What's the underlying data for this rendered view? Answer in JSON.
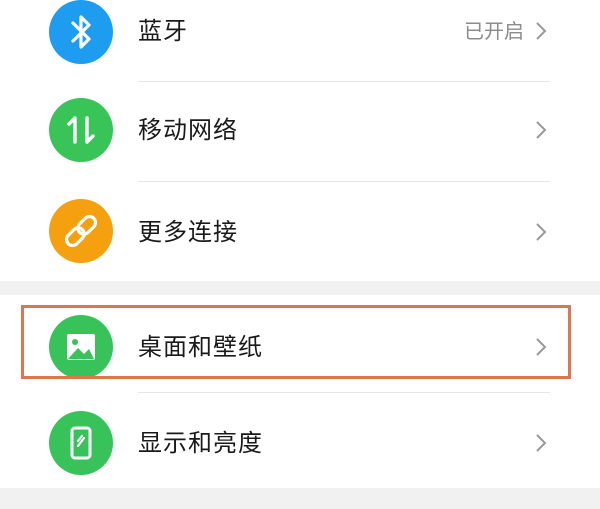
{
  "settings": {
    "items": [
      {
        "label": "蓝牙",
        "status": "已开启",
        "icon": "bluetooth-icon",
        "color": "#1e9cf0"
      },
      {
        "label": "移动网络",
        "status": "",
        "icon": "mobile-data-icon",
        "color": "#39c458"
      },
      {
        "label": "更多连接",
        "status": "",
        "icon": "link-icon",
        "color": "#f5a00f"
      },
      {
        "label": "桌面和壁纸",
        "status": "",
        "icon": "image-icon",
        "color": "#37c35a",
        "highlighted": true
      },
      {
        "label": "显示和亮度",
        "status": "",
        "icon": "display-icon",
        "color": "#37c35a"
      }
    ]
  },
  "colors": {
    "highlight_border": "#d9784f",
    "page_background": "#f1f1f1",
    "divider": "#e6e6e6"
  }
}
